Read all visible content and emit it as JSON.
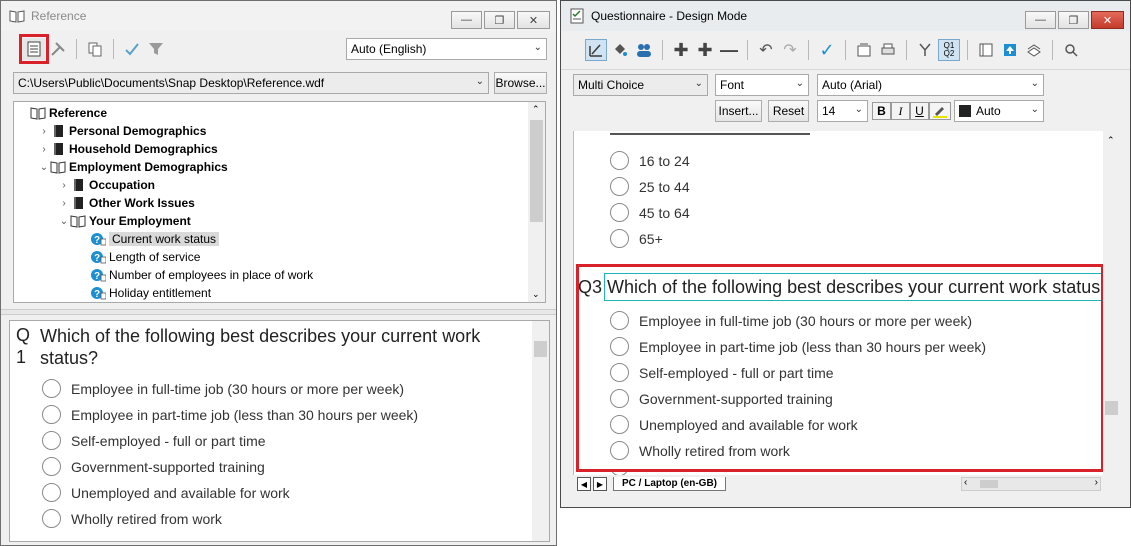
{
  "reference_window": {
    "title": "Reference",
    "language_select": "Auto (English)",
    "path": "C:\\Users\\Public\\Documents\\Snap Desktop\\Reference.wdf",
    "browse_label": "Browse...",
    "tree": [
      {
        "label": "Reference",
        "level": 0,
        "bold": true,
        "expander": "",
        "icon": "open-book-icon"
      },
      {
        "label": "Personal Demographics",
        "level": 1,
        "bold": true,
        "expander": ">",
        "icon": "closed-book-icon"
      },
      {
        "label": "Household Demographics",
        "level": 1,
        "bold": true,
        "expander": ">",
        "icon": "closed-book-icon"
      },
      {
        "label": "Employment Demographics",
        "level": 1,
        "bold": true,
        "expander": "v",
        "icon": "open-book-icon"
      },
      {
        "label": "Occupation",
        "level": 2,
        "bold": true,
        "expander": ">",
        "icon": "closed-book-icon"
      },
      {
        "label": "Other Work Issues",
        "level": 2,
        "bold": true,
        "expander": ">",
        "icon": "closed-book-icon"
      },
      {
        "label": "Your Employment",
        "level": 2,
        "bold": true,
        "expander": "v",
        "icon": "open-book-icon"
      },
      {
        "label": "Current work status",
        "level": 3,
        "bold": false,
        "expander": "",
        "icon": "question-icon",
        "selected": true
      },
      {
        "label": "Length of service",
        "level": 3,
        "bold": false,
        "expander": "",
        "icon": "question-icon"
      },
      {
        "label": "Number of employees in place of work",
        "level": 3,
        "bold": false,
        "expander": "",
        "icon": "question-icon"
      },
      {
        "label": "Holiday entitlement",
        "level": 3,
        "bold": false,
        "expander": "",
        "icon": "question-icon"
      }
    ],
    "preview": {
      "q_label_1": "Q",
      "q_label_2": "1",
      "question_line1": "Which of the following best describes your current work",
      "question_line2": "status?",
      "options": [
        "Employee in full-time job (30 hours or more per week)",
        "Employee in part-time job (less than 30 hours per week)",
        "Self-employed - full or part time",
        "Government-supported training",
        "Unemployed and available for work",
        "Wholly retired from work"
      ]
    }
  },
  "questionnaire_window": {
    "title": "Questionnaire - Design Mode",
    "question_type": "Multi Choice",
    "font_select": "Font",
    "font_name": "Auto (Arial)",
    "insert_label": "Insert...",
    "reset_label": "Reset",
    "font_size": "14",
    "bold_label": "B",
    "italic_label": "I",
    "underline_label": "U",
    "color_label": "Auto",
    "age_options": [
      "16 to 24",
      "25 to 44",
      "45 to 64",
      "65+"
    ],
    "q3_label": "Q3",
    "q3_text": "Which of the following best describes your current work status?",
    "q3_options": [
      "Employee in full-time job (30 hours or more per week)",
      "Employee in part-time job (less than 30 hours per week)",
      "Self-employed - full or part time",
      "Government-supported training",
      "Unemployed and available for work",
      "Wholly retired from work"
    ],
    "tab_label": "PC / Laptop (en-GB)"
  },
  "colors": {
    "highlight": "#d9212a",
    "focus": "#1fb3b3",
    "question_icon": "#1a8fd4"
  }
}
